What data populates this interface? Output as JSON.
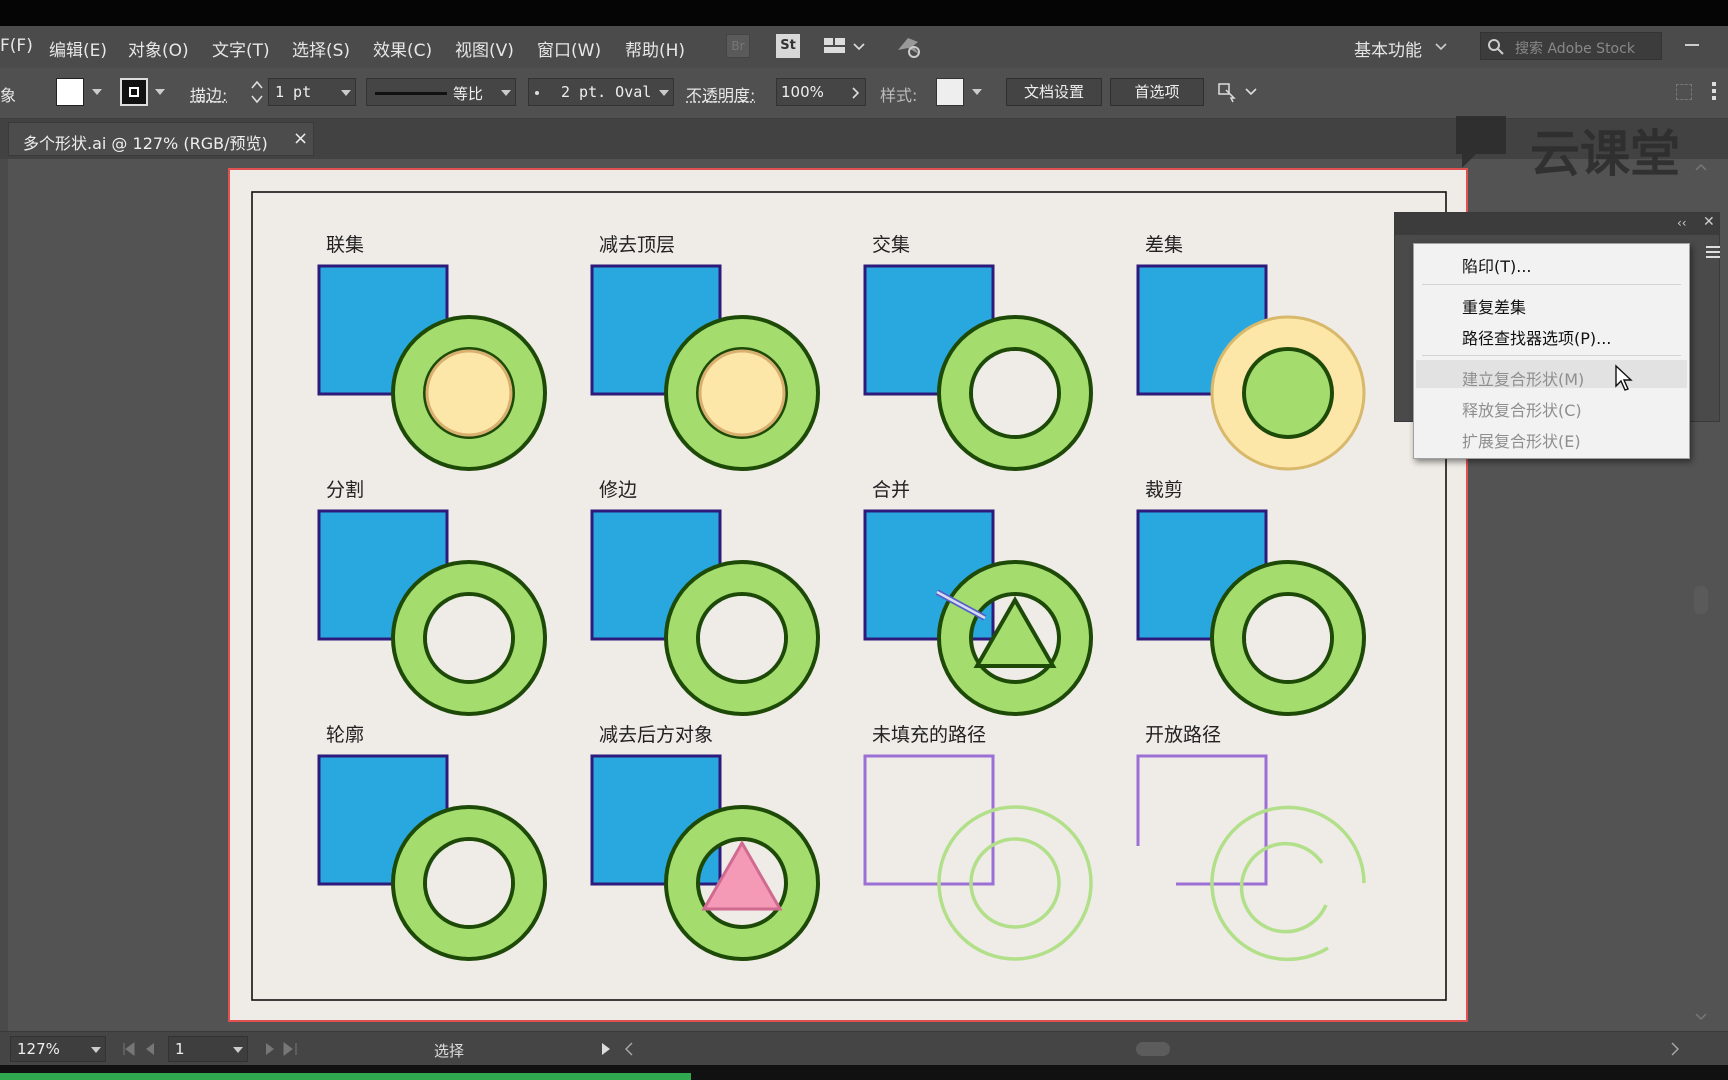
{
  "menu": {
    "items": [
      {
        "label": "F(F)"
      },
      {
        "label": "编辑(E)"
      },
      {
        "label": "对象(O)"
      },
      {
        "label": "文字(T)"
      },
      {
        "label": "选择(S)"
      },
      {
        "label": "效果(C)"
      },
      {
        "label": "视图(V)"
      },
      {
        "label": "窗口(W)"
      },
      {
        "label": "帮助(H)"
      }
    ],
    "br_label": "Br",
    "st_label": "St",
    "workspace": "基本功能",
    "search_placeholder": "搜索 Adobe Stock"
  },
  "control": {
    "left_char": "象",
    "stroke_label": "描边:",
    "stroke_value": "1 pt",
    "stroke_profile": "等比",
    "brush": "2 pt. Oval",
    "opacity_label": "不透明度:",
    "opacity_value": "100%",
    "style_label": "样式:",
    "doc_setup": "文档设置",
    "preferences": "首选项"
  },
  "tab": {
    "title": "多个形状.ai @ 127% (RGB/预览)",
    "close": "×"
  },
  "watermark": "云课堂",
  "shapes": {
    "labels": [
      "联集",
      "减去顶层",
      "交集",
      "差集",
      "分割",
      "修边",
      "合并",
      "裁剪",
      "轮廓",
      "减去后方对象",
      "未填充的路径",
      "开放路径"
    ]
  },
  "context_menu": {
    "items": [
      {
        "label": "陷印(T)...",
        "enabled": true
      },
      {
        "label": "重复差集",
        "enabled": true
      },
      {
        "label": "路径查找器选项(P)...",
        "enabled": true
      },
      {
        "label": "建立复合形状(M)",
        "enabled": false
      },
      {
        "label": "释放复合形状(C)",
        "enabled": false
      },
      {
        "label": "扩展复合形状(E)",
        "enabled": false
      }
    ]
  },
  "status": {
    "zoom": "127%",
    "page": "1",
    "tool": "选择"
  },
  "colors": {
    "blue_fill": "#29a8e0",
    "blue_stroke": "#2d1a7a",
    "green_fill": "#a4dc6e",
    "green_stroke": "#1e4a08",
    "yellow_fill": "#fde7a8",
    "pink_fill": "#f49ab6",
    "purple_line": "#9b6fd6",
    "light_green_line": "#b2e08a",
    "artboard_border": "#e05050",
    "progress": "#2fa84f"
  },
  "progress_fraction": 0.4
}
